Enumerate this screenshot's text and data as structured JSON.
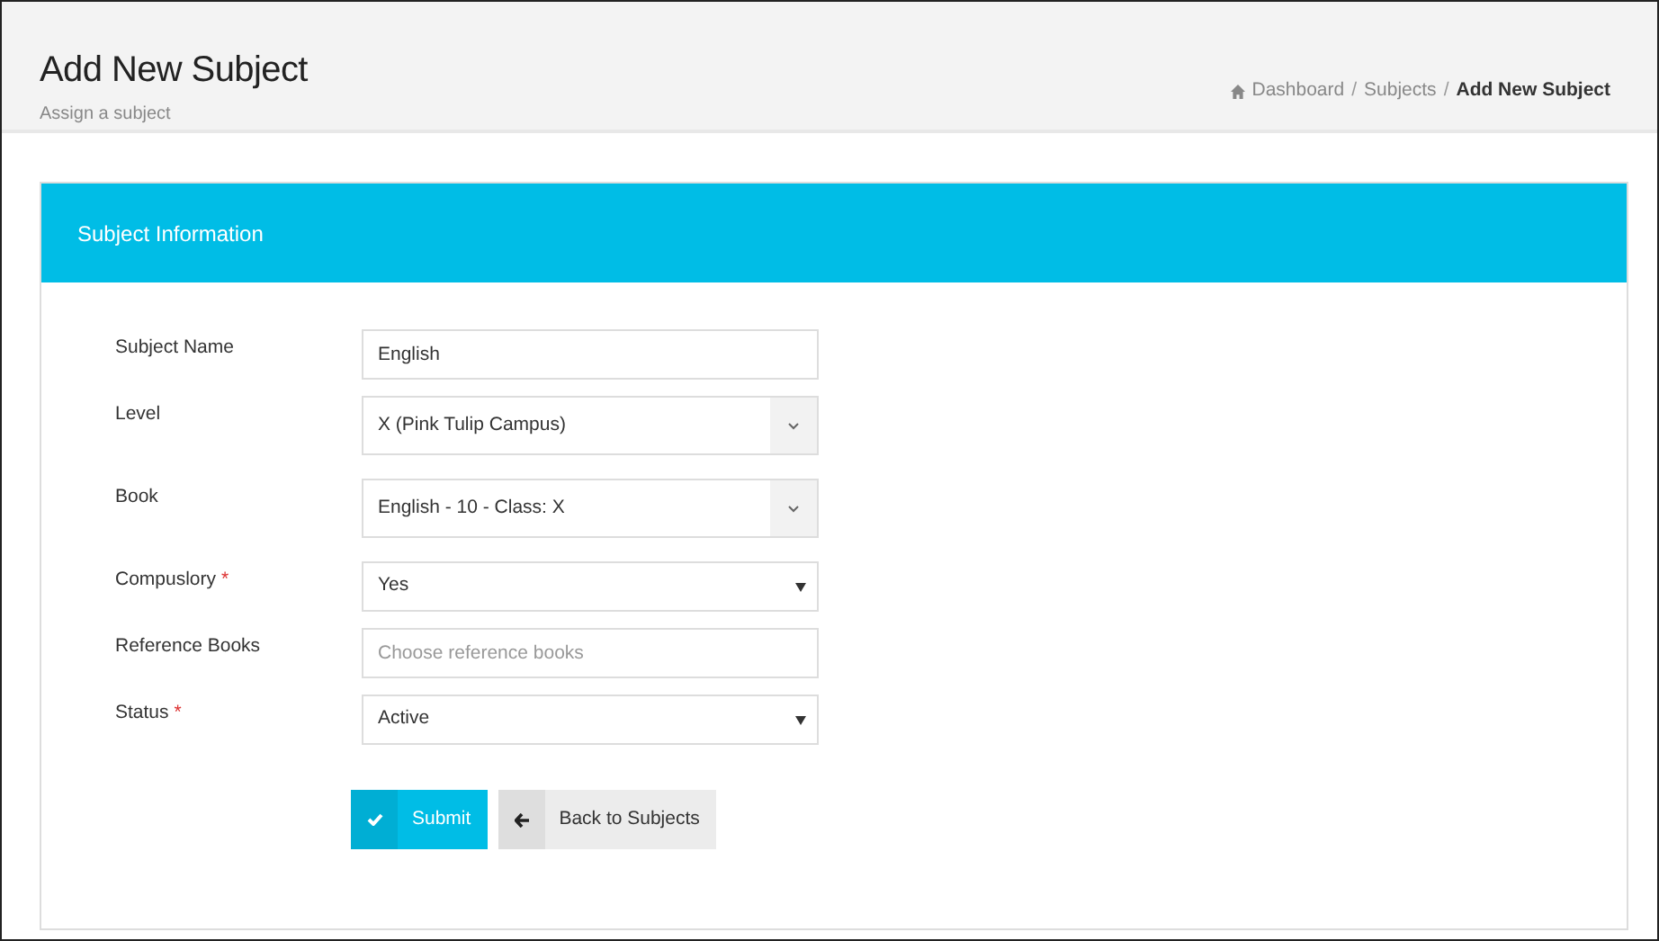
{
  "header": {
    "title": "Add New Subject",
    "subtitle": "Assign a subject"
  },
  "breadcrumb": [
    {
      "label": "Dashboard",
      "kind": "home"
    },
    {
      "separator": "/",
      "label": "Subjects",
      "kind": "link"
    },
    {
      "separator": "/",
      "label": "Add New Subject",
      "kind": "current"
    }
  ],
  "card": {
    "title": "Subject Information"
  },
  "fields": [
    {
      "label": "Subject Name",
      "kind": "text",
      "value": "English"
    },
    {
      "label": "Level",
      "kind": "combo",
      "value": "X (Pink Tulip Campus)"
    },
    {
      "label": "Book",
      "kind": "combo",
      "value": "English - 10 - Class: X"
    },
    {
      "label": "Compuslory",
      "required_mark": "*",
      "kind": "select",
      "value": "Yes"
    },
    {
      "label": "Reference Books",
      "kind": "text",
      "placeholder": "Choose reference books"
    },
    {
      "label": "Status",
      "required_mark": "*",
      "kind": "select",
      "value": "Active"
    }
  ],
  "buttons": [
    {
      "label": "Submit",
      "kind": "primary"
    },
    {
      "label": "Back to Subjects",
      "kind": "back"
    }
  ]
}
